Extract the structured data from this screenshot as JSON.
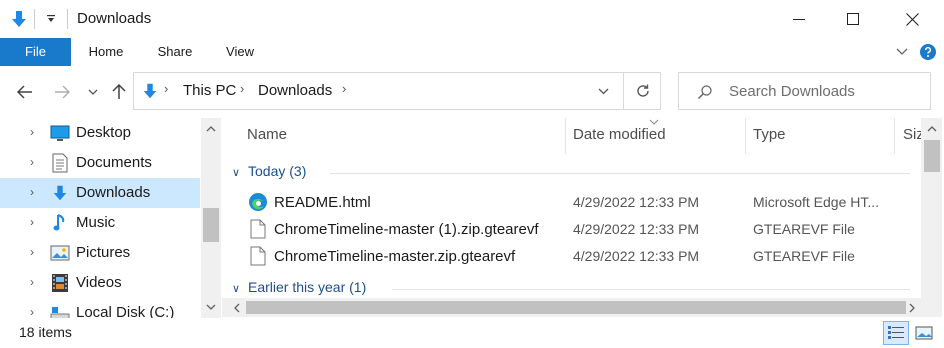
{
  "titlebar": {
    "title": "Downloads",
    "icons": [
      "downloads-arrow-icon",
      "qat-dropdown-icon",
      "minimize-icon",
      "maximize-icon",
      "close-icon"
    ]
  },
  "ribbon": {
    "tabs": [
      {
        "label": "File",
        "active": true
      },
      {
        "label": "Home",
        "active": false
      },
      {
        "label": "Share",
        "active": false
      },
      {
        "label": "View",
        "active": false
      }
    ]
  },
  "address": {
    "crumbs": [
      "This PC",
      "Downloads"
    ],
    "search_placeholder": "Search Downloads"
  },
  "nav_pane": {
    "items": [
      {
        "label": "Desktop",
        "icon": "desktop-icon",
        "selected": false
      },
      {
        "label": "Documents",
        "icon": "documents-icon",
        "selected": false
      },
      {
        "label": "Downloads",
        "icon": "downloads-icon",
        "selected": true
      },
      {
        "label": "Music",
        "icon": "music-icon",
        "selected": false
      },
      {
        "label": "Pictures",
        "icon": "pictures-icon",
        "selected": false
      },
      {
        "label": "Videos",
        "icon": "videos-icon",
        "selected": false
      },
      {
        "label": "Local Disk (C:)",
        "icon": "local-disk-icon",
        "selected": false
      }
    ]
  },
  "file_list": {
    "columns": [
      "Name",
      "Date modified",
      "Type",
      "Siz"
    ],
    "groups": [
      {
        "label": "Today (3)",
        "files": [
          {
            "name": "README.html",
            "date": "4/29/2022 12:33 PM",
            "type": "Microsoft Edge HT...",
            "icon": "edge-icon"
          },
          {
            "name": "ChromeTimeline-master (1).zip.gtearevf",
            "date": "4/29/2022 12:33 PM",
            "type": "GTEAREVF File",
            "icon": "file-icon"
          },
          {
            "name": "ChromeTimeline-master.zip.gtearevf",
            "date": "4/29/2022 12:33 PM",
            "type": "GTEAREVF File",
            "icon": "file-icon"
          }
        ]
      },
      {
        "label": "Earlier this year (1)",
        "files": []
      }
    ]
  },
  "status": {
    "count": "18 items"
  },
  "colors": {
    "accent": "#1979ca",
    "selection": "#cce8ff",
    "group_header": "#1e4e8c"
  }
}
